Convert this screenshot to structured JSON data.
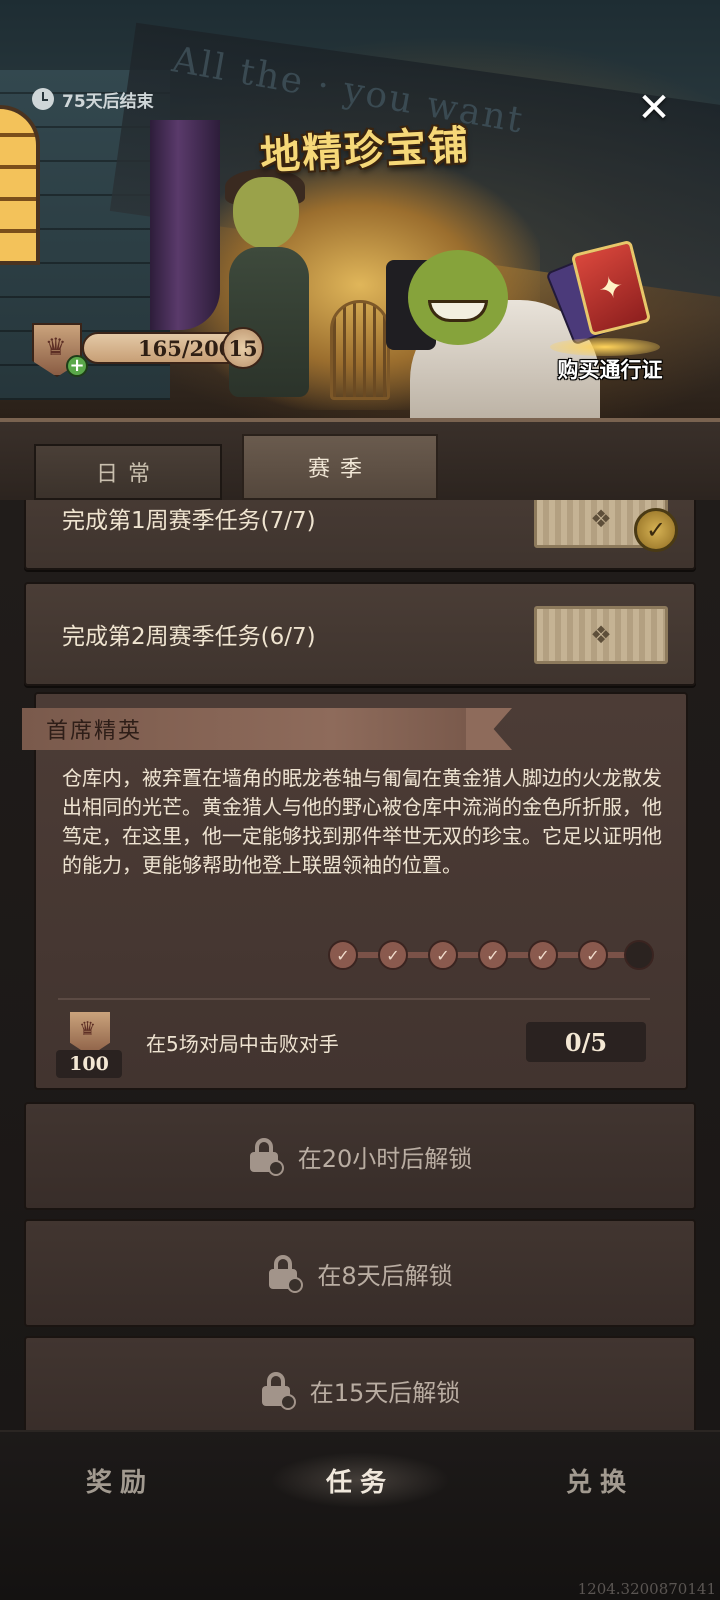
{
  "banner": {
    "timer_text": "75天后结束",
    "title": "地精珍宝铺",
    "progress_text": "165/200",
    "level": "15",
    "buy_pass_label": "购买通行证",
    "close_icon": "close-icon"
  },
  "tabs": [
    {
      "label": "日常",
      "active": false
    },
    {
      "label": "赛季",
      "active": true
    }
  ],
  "quests": [
    {
      "text": "完成第1周赛季任务(7/7)",
      "completed": true
    },
    {
      "text": "完成第2周赛季任务(6/7)",
      "completed": false
    }
  ],
  "elite": {
    "title": "首席精英",
    "description": "仓库内，被弃置在墙角的眠龙卷轴与匍匐在黄金猎人脚边的火龙散发出相同的光芒。黄金猎人与他的野心被仓库中流淌的金色所折服，他笃定，在这里，他一定能够找到那件举世无双的珍宝。它足以证明他的能力，更能够帮助他登上联盟领袖的位置。",
    "steps_done": 6,
    "steps_total": 7,
    "reward_amount": "100",
    "task_text": "在5场对局中击败对手",
    "task_count": "0/5"
  },
  "locked": [
    {
      "text": "在20小时后解锁"
    },
    {
      "text": "在8天后解锁"
    },
    {
      "text": "在15天后解锁"
    }
  ],
  "nav": {
    "rewards": "奖励",
    "tasks": "任务",
    "exchange": "兑换"
  },
  "version": "1204.3200870141"
}
